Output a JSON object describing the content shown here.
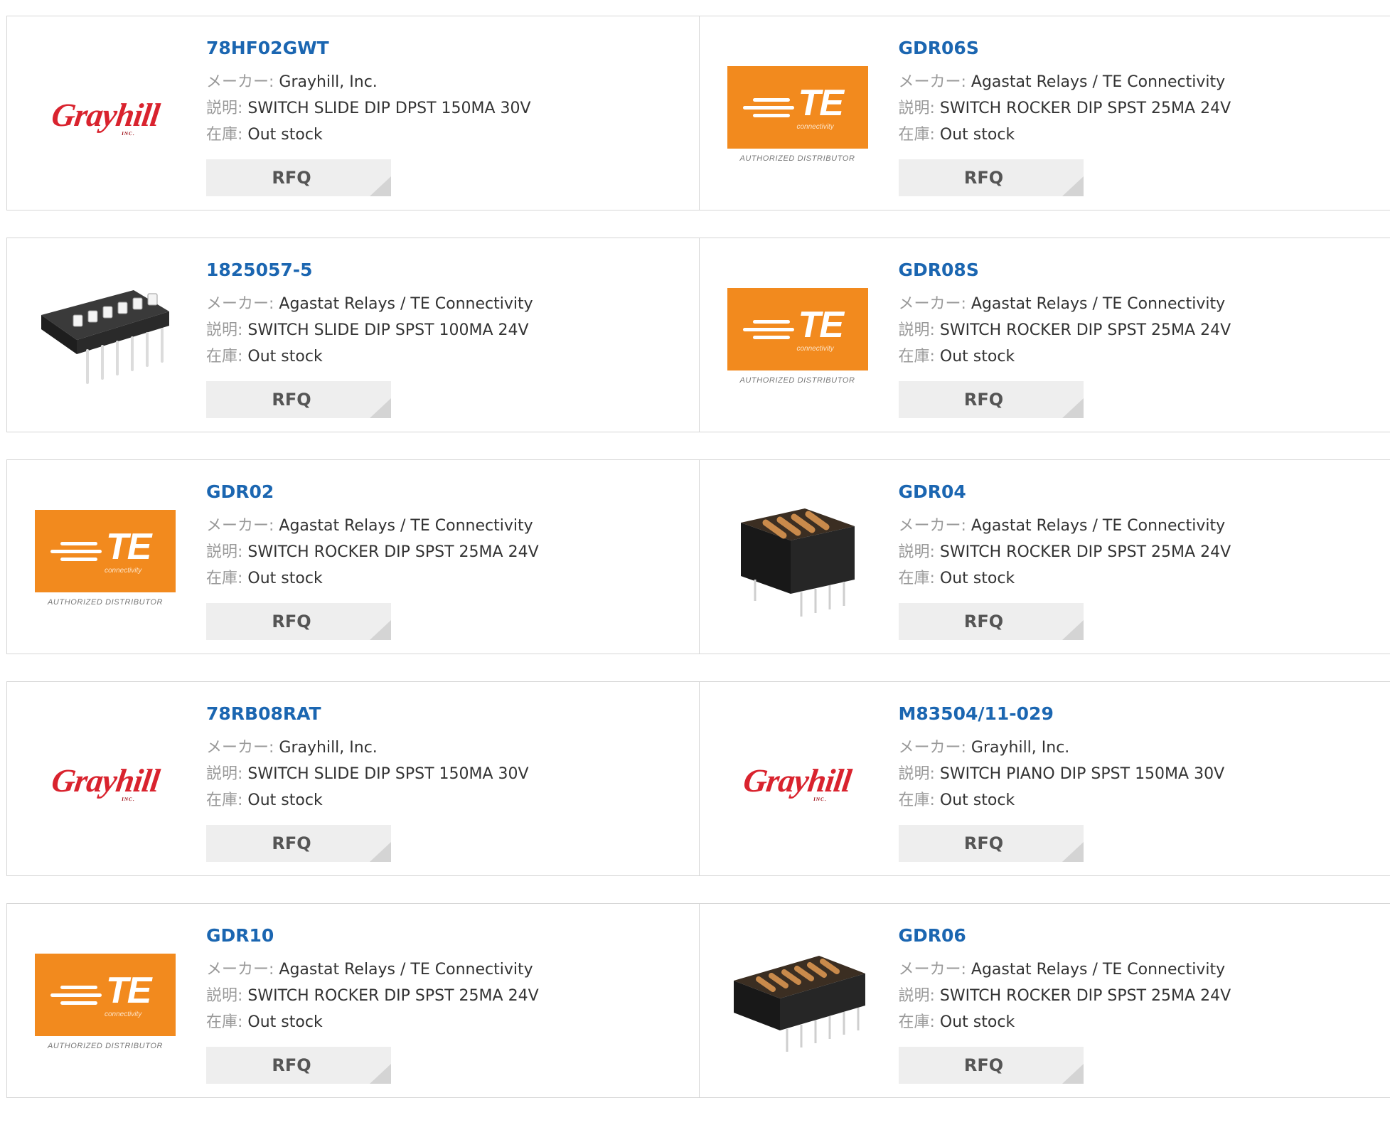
{
  "labels": {
    "maker": "メーカー:",
    "desc": "説明:",
    "stock": "在庫:",
    "rfq": "RFQ"
  },
  "logos": {
    "te_letters": "TE",
    "te_conn": "connectivity",
    "te_auth": "AUTHORIZED DISTRIBUTOR",
    "grayhill": "Grayhill",
    "grayhill_inc": "INC."
  },
  "colors": {
    "title": "#1b66b1",
    "te_orange": "#f28a1e",
    "grayhill_red": "#d9232e"
  },
  "products": [
    {
      "part": "78HF02GWT",
      "maker": "Grayhill, Inc.",
      "desc": "SWITCH SLIDE DIP DPST 150MA 30V",
      "stock": "Out stock",
      "image": "grayhill-logo"
    },
    {
      "part": "GDR06S",
      "maker": "Agastat Relays / TE Connectivity",
      "desc": "SWITCH ROCKER DIP SPST 25MA 24V",
      "stock": "Out stock",
      "image": "te-connectivity-logo"
    },
    {
      "part": "1825057-5",
      "maker": "Agastat Relays / TE Connectivity",
      "desc": "SWITCH SLIDE DIP SPST 100MA 24V",
      "stock": "Out stock",
      "image": "dip-switch-black-white-photo"
    },
    {
      "part": "GDR08S",
      "maker": "Agastat Relays / TE Connectivity",
      "desc": "SWITCH ROCKER DIP SPST 25MA 24V",
      "stock": "Out stock",
      "image": "te-connectivity-logo"
    },
    {
      "part": "GDR02",
      "maker": "Agastat Relays / TE Connectivity",
      "desc": "SWITCH ROCKER DIP SPST 25MA 24V",
      "stock": "Out stock",
      "image": "te-connectivity-logo"
    },
    {
      "part": "GDR04",
      "maker": "Agastat Relays / TE Connectivity",
      "desc": "SWITCH ROCKER DIP SPST 25MA 24V",
      "stock": "Out stock",
      "image": "rocker-dip-4-photo"
    },
    {
      "part": "78RB08RAT",
      "maker": "Grayhill, Inc.",
      "desc": "SWITCH SLIDE DIP SPST 150MA 30V",
      "stock": "Out stock",
      "image": "grayhill-logo"
    },
    {
      "part": "M83504/11-029",
      "maker": "Grayhill, Inc.",
      "desc": "SWITCH PIANO DIP SPST 150MA 30V",
      "stock": "Out stock",
      "image": "grayhill-logo"
    },
    {
      "part": "GDR10",
      "maker": "Agastat Relays / TE Connectivity",
      "desc": "SWITCH ROCKER DIP SPST 25MA 24V",
      "stock": "Out stock",
      "image": "te-connectivity-logo"
    },
    {
      "part": "GDR06",
      "maker": "Agastat Relays / TE Connectivity",
      "desc": "SWITCH ROCKER DIP SPST 25MA 24V",
      "stock": "Out stock",
      "image": "rocker-dip-6-photo"
    }
  ]
}
